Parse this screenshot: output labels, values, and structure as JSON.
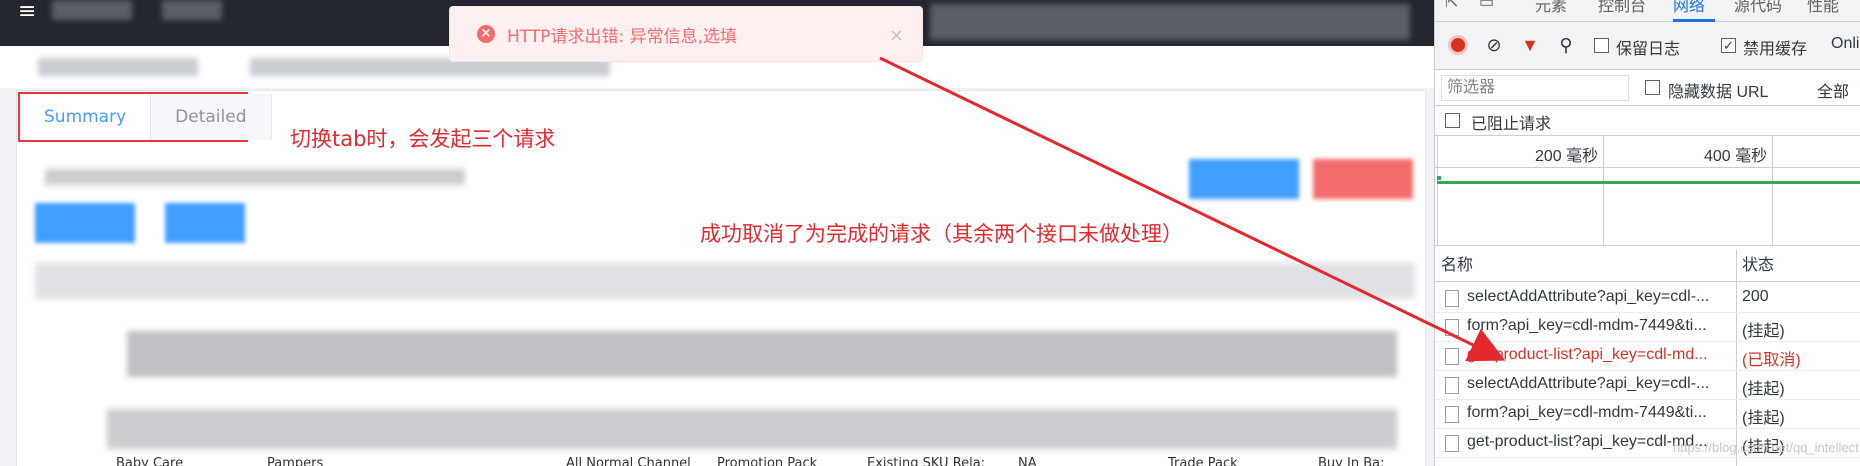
{
  "toast": {
    "message": "HTTP请求出错: 异常信息,选填",
    "close_label": "×"
  },
  "tabs": [
    {
      "label": "Summary",
      "active": true
    },
    {
      "label": "Detailed",
      "active": false
    }
  ],
  "annotations": {
    "tab_switch": "切换tab时，会发起三个请求",
    "cancelled": "成功取消了为完成的请求（其余两个接口未做处理）"
  },
  "footer_labels": [
    "Baby Care",
    "Pampers",
    "All Normal Channel",
    "Promotion Pack",
    "Existing SKU Rela:",
    "NA",
    "Trade Pack",
    "Buy In Ba:"
  ],
  "devtools": {
    "tabs": [
      "元素",
      "控制台",
      "网络",
      "源代码",
      "性能"
    ],
    "active_tab": "网络",
    "toolbar": {
      "preserve_log": "保留日志",
      "disable_cache": "禁用缓存",
      "online": "Onli"
    },
    "filter": {
      "placeholder": "筛选器",
      "hide_data_url": "隐藏数据 URL",
      "all": "全部",
      "blocked_requests": "已阻止请求"
    },
    "timeline": {
      "tick_200": "200 毫秒",
      "tick_400": "400 毫秒"
    },
    "table": {
      "col_name": "名称",
      "col_status": "状态",
      "rows": [
        {
          "name": "selectAddAttribute?api_key=cdl-...",
          "status": "200",
          "error": false
        },
        {
          "name": "form?api_key=cdl-mdm-7449&ti...",
          "status": "(挂起)",
          "error": false
        },
        {
          "name": "get-product-list?api_key=cdl-md...",
          "status": "(已取消)",
          "error": true
        },
        {
          "name": "selectAddAttribute?api_key=cdl-...",
          "status": "(挂起)",
          "error": false
        },
        {
          "name": "form?api_key=cdl-mdm-7449&ti...",
          "status": "(挂起)",
          "error": false
        },
        {
          "name": "get-product-list?api_key=cdl-md...",
          "status": "(挂起)",
          "error": false
        }
      ]
    }
  },
  "watermark": "https://blog.csdn.net/qq_intellect"
}
